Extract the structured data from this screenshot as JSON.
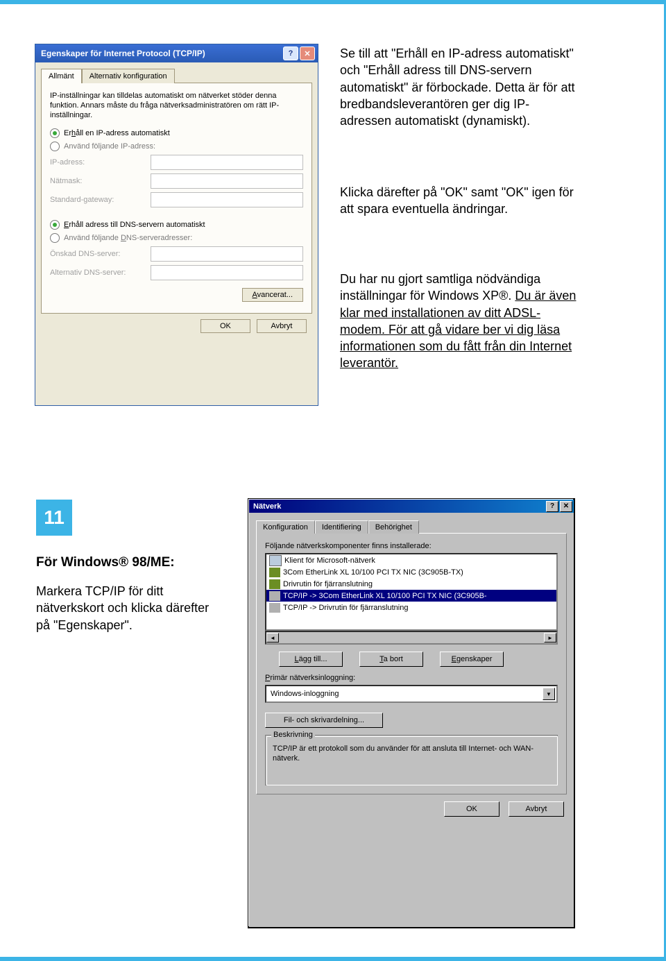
{
  "instructions": {
    "block1": "Se till att \"Erhåll en IP-adress automatiskt\" och \"Erhåll adress till DNS-servern automatiskt\" är förbockade. Detta är för att bredbandsleverantören ger dig IP-adressen automatiskt (dynamiskt).",
    "block2": "Klicka därefter på \"OK\" samt \"OK\" igen för att spara eventuella ändringar.",
    "block3a": "Du har nu gjort samtliga nödvändiga inställningar för Windows XP®. ",
    "block3b": "Du är även klar med installationen av ditt ADSL-modem. ",
    "block3c": "För att gå vidare ber vi dig läsa informationen som du fått från din Internet leverantör."
  },
  "step": {
    "number": "11",
    "title": "För Windows® 98/ME:",
    "body": "Markera TCP/IP för ditt nätverkskort och klicka därefter på \"Egenskaper\"."
  },
  "xp": {
    "title": "Egenskaper för Internet Protocol (TCP/IP)",
    "tabs": {
      "active": "Allmänt",
      "alt": "Alternativ konfiguration"
    },
    "desc": "IP-inställningar kan tilldelas automatiskt om nätverket stöder denna funktion. Annars måste du fråga nätverksadministratören om rätt IP-inställningar.",
    "radio_ip_auto": "Erhåll en IP-adress automatiskt",
    "radio_ip_man": "Använd följande IP-adress:",
    "lbl_ipaddr": "IP-adress:",
    "lbl_mask": "Nätmask:",
    "lbl_gw": "Standard-gateway:",
    "radio_dns_auto": "Erhåll adress till DNS-servern automatiskt",
    "radio_dns_man": "Använd följande DNS-serveradresser:",
    "lbl_dns1": "Önskad DNS-server:",
    "lbl_dns2": "Alternativ DNS-server:",
    "adv": "Avancerat...",
    "ok": "OK",
    "cancel": "Avbryt"
  },
  "w9": {
    "title": "Nätverk",
    "tabs": {
      "conf": "Konfiguration",
      "ident": "Identifiering",
      "perm": "Behörighet"
    },
    "list_label": "Följande nätverkskomponenter finns installerade:",
    "items": [
      "Klient för Microsoft-nätverk",
      "3Com EtherLink XL 10/100 PCI TX NIC (3C905B-TX)",
      "Drivrutin för fjärranslutning",
      "TCP/IP -> 3Com EtherLink XL 10/100 PCI TX NIC (3C905B-",
      "TCP/IP -> Drivrutin för fjärranslutning"
    ],
    "btn_add": "Lägg till...",
    "btn_del": "Ta bort",
    "btn_prop": "Egenskaper",
    "login_label": "Primär nätverksinloggning:",
    "login_value": "Windows-inloggning",
    "btn_share": "Fil- och skrivardelning...",
    "desc_title": "Beskrivning",
    "desc_text": "TCP/IP är ett protokoll som du använder för att ansluta till Internet- och WAN-nätverk.",
    "ok": "OK",
    "cancel": "Avbryt"
  }
}
